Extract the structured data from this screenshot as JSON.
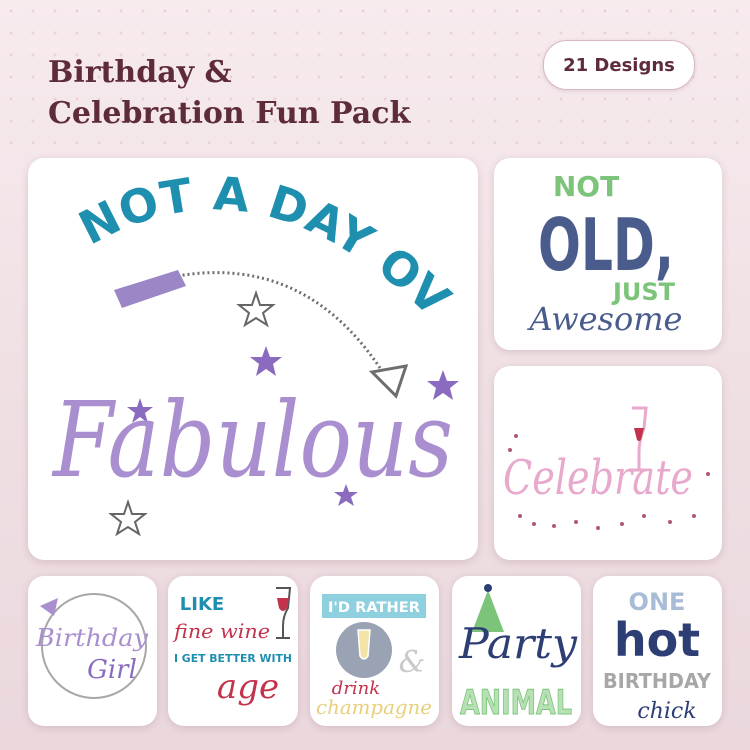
{
  "header": {
    "title_line1": "Birthday &",
    "title_line2": "Celebration Fun Pack",
    "badge": "21 Designs"
  },
  "designs": {
    "fabulous": {
      "line1": "NOT A DAY OVER",
      "word": "Fabulous"
    },
    "old": {
      "not": "NOT",
      "old": "OLD,",
      "just": "JUST",
      "awesome": "Awesome"
    },
    "celebrate": {
      "word": "Celebrate"
    },
    "birthday_girl": {
      "birthday": "Birthday",
      "girl": "Girl"
    },
    "fine_wine": {
      "like": "LIKE",
      "fine": "fine wine",
      "better": "I GET BETTER WITH",
      "age": "age"
    },
    "champagne": {
      "banner": "I'D RATHER",
      "amp": "&",
      "drink": "drink",
      "champagne": "champagne"
    },
    "party": {
      "party": "Party",
      "animal": "ANIMAL"
    },
    "hot": {
      "one": "ONE",
      "hot": "hot",
      "birthday": "BIRTHDAY",
      "chick": "chick"
    }
  },
  "colors": {
    "teal": "#1f8fb0",
    "lavender": "#a98fd0",
    "purple": "#8a6bbf",
    "navy": "#2d3e75",
    "slate": "#4a5c8c",
    "green": "#7cc47a",
    "pink": "#e7a9cc",
    "wine": "#c4334c",
    "gray": "#7a7a7a",
    "title": "#5e2b3a"
  }
}
